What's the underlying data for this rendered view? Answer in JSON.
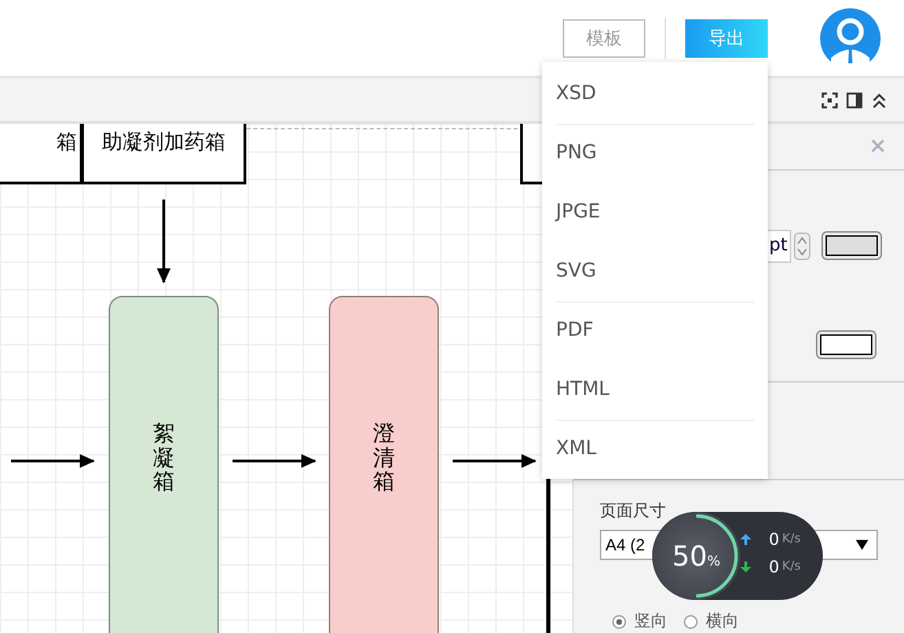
{
  "header": {
    "buttons": [
      {
        "label": "模板",
        "kind": "outline"
      },
      {
        "label": "导出",
        "kind": "primary"
      }
    ]
  },
  "diagram": {
    "top_boxes": [
      {
        "label": "箱",
        "kind": "process"
      },
      {
        "label": "助凝剂加药箱",
        "kind": "process"
      },
      {
        "kind": "process"
      }
    ],
    "tanks": [
      {
        "label": "絮凝箱",
        "color": "#d5e8d4"
      },
      {
        "label": "澄清箱",
        "color": "#f8cecc"
      }
    ]
  },
  "export_menu": [
    {
      "label": "XSD",
      "divider_after": true
    },
    {
      "label": "PNG",
      "divider_after": false
    },
    {
      "label": "JPGE",
      "divider_after": false
    },
    {
      "label": "SVG",
      "divider_after": true
    },
    {
      "label": "PDF",
      "divider_after": false
    },
    {
      "label": "HTML",
      "divider_after": true
    },
    {
      "label": "XML",
      "divider_after": false
    }
  ],
  "panel": {
    "unit": "pt",
    "page_size_label": "页面尺寸",
    "page_size_value": "A4 (2",
    "orientation": [
      {
        "label": "竖向",
        "selected": true
      },
      {
        "label": "横向",
        "selected": false
      }
    ]
  },
  "speed_widget": {
    "percent": "50",
    "percent_unit": "%",
    "level": 0.5,
    "upload": "0",
    "upload_unit": "K/s",
    "download": "0",
    "download_unit": "K/s"
  }
}
